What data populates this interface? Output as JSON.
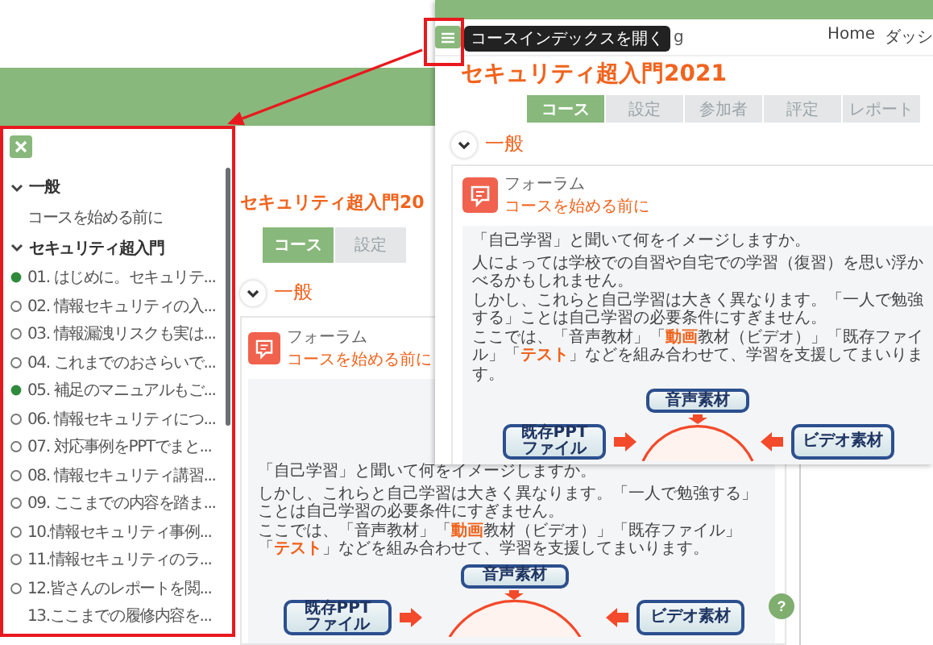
{
  "back_screen": {
    "index_tooltip": "コースインデックスを開く",
    "site_name": "g",
    "nav_links": [
      "Home",
      "ダッシ"
    ],
    "course_title": "セキュリティ超入門2021",
    "tabs": [
      {
        "label": "コース",
        "selected": true
      },
      {
        "label": "設定",
        "selected": false
      },
      {
        "label": "参加者",
        "selected": false
      },
      {
        "label": "評定",
        "selected": false
      },
      {
        "label": "レポート",
        "selected": false
      }
    ],
    "section": {
      "title": "一般",
      "expanded": true
    },
    "activity": {
      "type_label": "フォーラム",
      "name": "コースを始める前に"
    },
    "description": [
      "「自己学習」と聞いて何をイメージしますか。",
      "人によっては学校での自習や自宅での学習（復習）を思い浮かべるかもしれません。",
      "しかし、これらと自己学習は大きく異なります。「一人で勉強する」ことは自己学習の必要条件にすぎません。",
      "ここでは、「音声教材」「**動画**教材（ビデオ）」「既存ファイル」「**テスト**」などを組み合わせて、学習を支援してまいります。"
    ],
    "diagram": {
      "top": [
        "音声素材"
      ],
      "left": [
        "既存PPT",
        "ファイル"
      ],
      "right": [
        "ビデオ素材"
      ]
    }
  },
  "front_screen": {
    "course_index": {
      "sections": [
        {
          "title": "一般",
          "expanded": true,
          "children": [
            {
              "label": "コースを始める前に",
              "kind": "plain"
            }
          ]
        },
        {
          "title": "セキュリティ超入門",
          "expanded": true,
          "children": [
            {
              "label": "01. はじめに。セキュリテ...",
              "kind": "complete"
            },
            {
              "label": "02. 情報セキュリティの入...",
              "kind": "incomplete"
            },
            {
              "label": "03. 情報漏洩リスクも実は...",
              "kind": "incomplete"
            },
            {
              "label": "04. これまでのおさらいで...",
              "kind": "incomplete"
            },
            {
              "label": "05. 補足のマニュアルもご...",
              "kind": "complete"
            },
            {
              "label": "06. 情報セキュリティにつ...",
              "kind": "incomplete"
            },
            {
              "label": "07. 対応事例をPPTでまと...",
              "kind": "incomplete"
            },
            {
              "label": "08. 情報セキュリティ講習...",
              "kind": "incomplete"
            },
            {
              "label": "09. ここまでの内容を踏ま...",
              "kind": "incomplete"
            },
            {
              "label": "10.情報セキュリティ事例...",
              "kind": "incomplete"
            },
            {
              "label": "11.情報セキュリティのラ...",
              "kind": "incomplete"
            },
            {
              "label": "12.皆さんのレポートを閲...",
              "kind": "incomplete"
            },
            {
              "label": "13.ここまでの履修内容を...",
              "kind": "plain"
            }
          ]
        }
      ]
    },
    "course_title": "セキュリティ超入門20",
    "tabs": [
      {
        "label": "コース",
        "selected": true
      },
      {
        "label": "設定",
        "selected": false
      }
    ],
    "section": {
      "title": "一般",
      "expanded": true
    },
    "activity": {
      "type_label": "フォーラム",
      "name": "コースを始める前に"
    },
    "description": [
      "「自己学習」と聞いて何をイメージしますか。",
      "しかし、これらと自己学習は大きく異なります。「一人で勉強する」ことは自己学習の必要条件にすぎません。",
      "ここでは、「音声教材」「**動画**教材（ビデオ）」「既存ファイル」「**テスト**」などを組み合わせて、学習を支援してまいります。"
    ],
    "diagram": {
      "top": [
        "音声素材"
      ],
      "left": [
        "既存PPT",
        "ファイル"
      ],
      "right": [
        "ビデオ素材"
      ]
    },
    "help_button": "?"
  }
}
